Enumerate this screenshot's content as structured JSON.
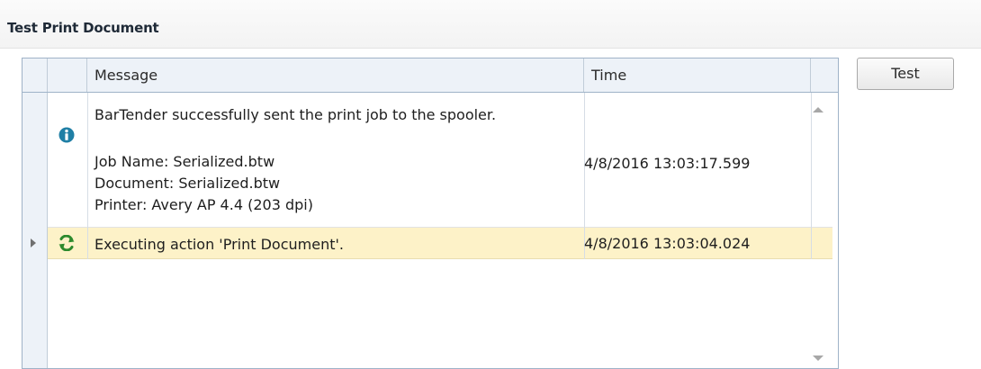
{
  "section": {
    "title": "Test Print Document"
  },
  "grid": {
    "columns": {
      "message": "Message",
      "time": "Time"
    },
    "rows": [
      {
        "icon": "info-icon",
        "message_lines": [
          "BarTender successfully sent the print job to the spooler.",
          "",
          "Job Name: Serialized.btw",
          "Document: Serialized.btw",
          "Printer: Avery AP 4.4 (203 dpi)"
        ],
        "time": "4/8/2016 13:03:17.599",
        "selected": false
      },
      {
        "icon": "execute-action-icon",
        "message_lines": [
          "Executing action 'Print Document'."
        ],
        "time": "4/8/2016 13:03:04.024",
        "selected": true
      }
    ]
  },
  "buttons": {
    "test_label": "Test"
  },
  "colors": {
    "selected_row": "#fdf2c8",
    "info_icon": "#1f7fa5",
    "execute_icon": "#2d8a2d"
  }
}
